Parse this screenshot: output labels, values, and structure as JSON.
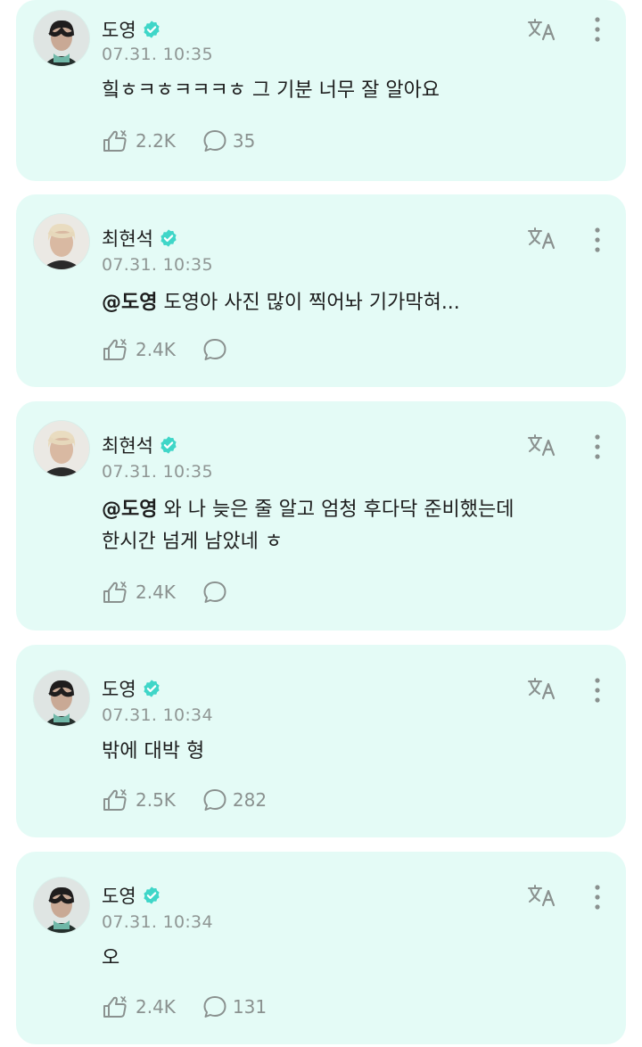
{
  "posts": [
    {
      "author": "도영",
      "author_id": "doyoung",
      "time": "07.31. 10:35",
      "mention": "",
      "text": "힠ㅎㅋㅎㅋㅋㅋㅎ 그 기분 너무 잘 알아요",
      "text_line2": "",
      "likes": "2.2K",
      "comments": "35"
    },
    {
      "author": "최현석",
      "author_id": "hyunsuk",
      "time": "07.31. 10:35",
      "mention": "@도영",
      "text": "도영아 사진 많이 찍어놔 기가막혀...",
      "text_line2": "",
      "likes": "2.4K",
      "comments": ""
    },
    {
      "author": "최현석",
      "author_id": "hyunsuk",
      "time": "07.31. 10:35",
      "mention": "@도영",
      "text": "와 나 늦은 줄 알고 엄청 후다닥 준비했는데",
      "text_line2": "한시간 넘게 남았네 ㅎ",
      "likes": "2.4K",
      "comments": ""
    },
    {
      "author": "도영",
      "author_id": "doyoung",
      "time": "07.31. 10:34",
      "mention": "",
      "text": "밖에 대박 형",
      "text_line2": "",
      "likes": "2.5K",
      "comments": "282"
    },
    {
      "author": "도영",
      "author_id": "doyoung",
      "time": "07.31. 10:34",
      "mention": "",
      "text": "오",
      "text_line2": "",
      "likes": "2.4K",
      "comments": "131"
    }
  ],
  "icons": {
    "verified": "verified-badge-icon",
    "translate": "translate-icon",
    "more": "more-vertical-icon",
    "like": "like-icon",
    "comment": "comment-icon"
  },
  "colors": {
    "card_background": "#e4fbf6",
    "verified_badge": "#3fd6c8",
    "meta_text": "#8f9694",
    "icon_gray": "#8a918f"
  }
}
